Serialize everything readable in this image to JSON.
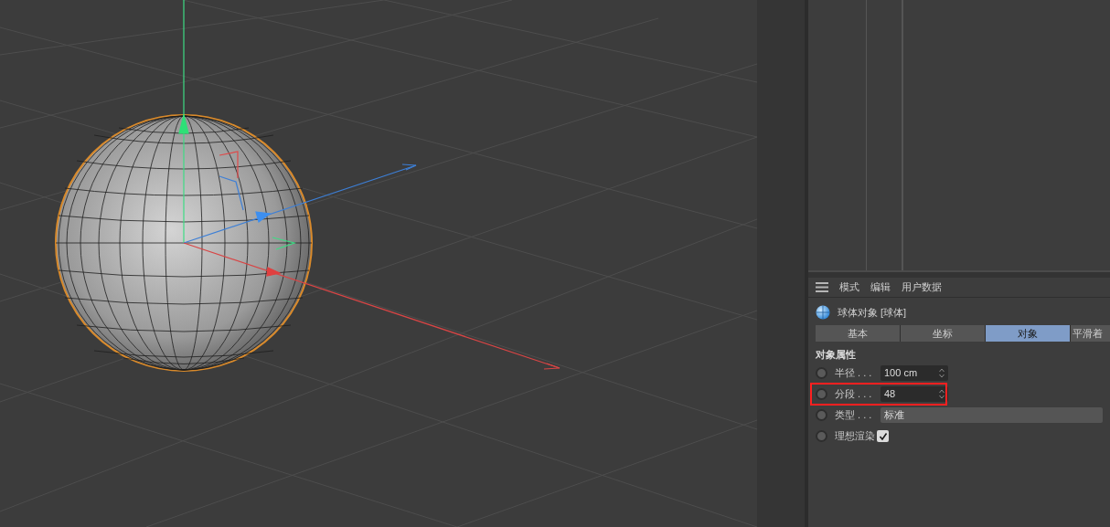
{
  "attributes": {
    "menu": [
      "模式",
      "编辑",
      "用户数据"
    ],
    "object_title": "球体对象 [球体]",
    "tabs": [
      {
        "label": "基本",
        "selected": false
      },
      {
        "label": "坐标",
        "selected": false
      },
      {
        "label": "对象",
        "selected": true
      },
      {
        "label": "平滑着",
        "selected": false
      }
    ],
    "section": "对象属性",
    "params": [
      {
        "kind": "number",
        "label": "半径 . . .",
        "value": "100 cm"
      },
      {
        "kind": "number",
        "label": "分段 . . .",
        "value": "48"
      },
      {
        "kind": "dropdown",
        "label": "类型 . . .",
        "value": "标准"
      },
      {
        "kind": "checkbox",
        "label": "理想渲染",
        "checked": true
      }
    ]
  }
}
